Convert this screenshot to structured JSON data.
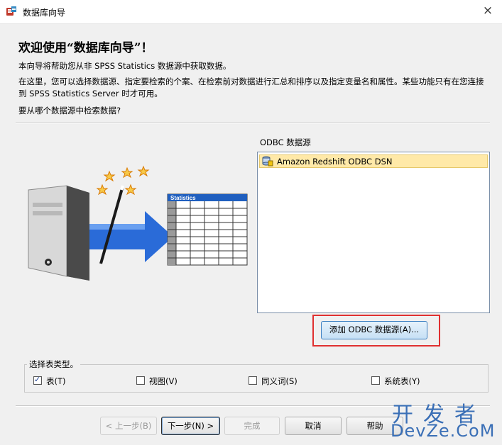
{
  "window": {
    "title": "数据库向导",
    "close_glyph": "×"
  },
  "intro": {
    "heading": "欢迎使用“数据库向导”！",
    "p1": "本向导将帮助您从非 SPSS Statistics 数据源中获取数据。",
    "p2": "在这里，您可以选择数据源、指定要检索的个案、在检索前对数据进行汇总和排序以及指定变量名和属性。某些功能只有在您连接到 SPSS Statistics Server 时才可用。",
    "p3": "要从哪个数据源中检索数据?"
  },
  "illustration": {
    "table_header": "Statistics"
  },
  "odbc": {
    "label": "ODBC 数据源",
    "items": [
      {
        "label": "Amazon Redshift ODBC DSN",
        "selected": true
      }
    ],
    "add_button": "添加 ODBC 数据源(A)..."
  },
  "table_types": {
    "legend": "选择表类型。",
    "options": [
      {
        "label": "表(T)",
        "checked": true
      },
      {
        "label": "视图(V)",
        "checked": false
      },
      {
        "label": "同义词(S)",
        "checked": false
      },
      {
        "label": "系统表(Y)",
        "checked": false
      }
    ]
  },
  "footer": {
    "back": "< 上一步(B)",
    "next": "下一步(N) >",
    "finish": "完成",
    "cancel": "取消",
    "help": "帮助"
  },
  "watermark": {
    "top": "开发者",
    "bottom": "DevZe.CoM"
  },
  "colors": {
    "highlight_red": "#e03030",
    "selected_item": "#ffe9a8",
    "button_blue": "#c6e0f5"
  }
}
